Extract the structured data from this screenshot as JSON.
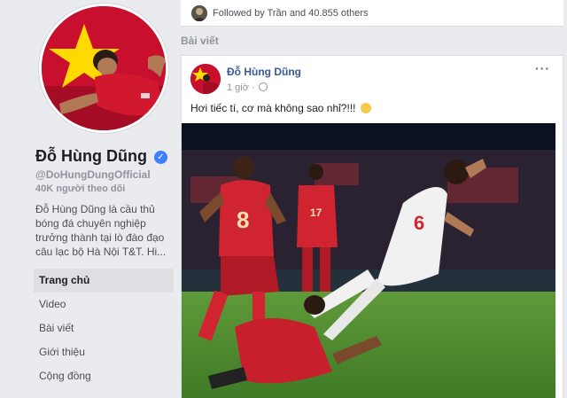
{
  "profile": {
    "name": "Đỗ Hùng Dũng",
    "verified_mark": "✓",
    "handle": "@DoHungDungOfficial",
    "followers": "40K người theo dõi",
    "bio": "Đỗ Hùng Dũng là cầu thủ bóng đá chuyên nghiệp trưởng thành tại lò đào đạo câu lạc bộ Hà Nội T&T. Hi..."
  },
  "nav": {
    "items": [
      {
        "label": "Trang chủ",
        "active": true
      },
      {
        "label": "Video"
      },
      {
        "label": "Bài viết"
      },
      {
        "label": "Giới thiệu"
      },
      {
        "label": "Cộng đồng"
      }
    ]
  },
  "followed": {
    "text": "Followed by Trần and 40.855 others"
  },
  "feed": {
    "section_title": "Bài viết"
  },
  "post": {
    "author": "Đỗ Hùng Dũng",
    "time": "1 giờ ·",
    "more": "···",
    "text": "Hơi tiếc tí, cơ mà không sao nhỉ?!!!",
    "photo_jersey_numbers": [
      "8",
      "17",
      "6"
    ]
  },
  "colors": {
    "page_bg": "#e9ebee",
    "link_blue": "#385898",
    "verified_blue": "#4080ff",
    "flag_red": "#c8102e",
    "flag_star": "#ffda00"
  },
  "icons": [
    "verified-badge-icon",
    "globe-icon",
    "more-options-icon",
    "smile-emoji-icon"
  ]
}
